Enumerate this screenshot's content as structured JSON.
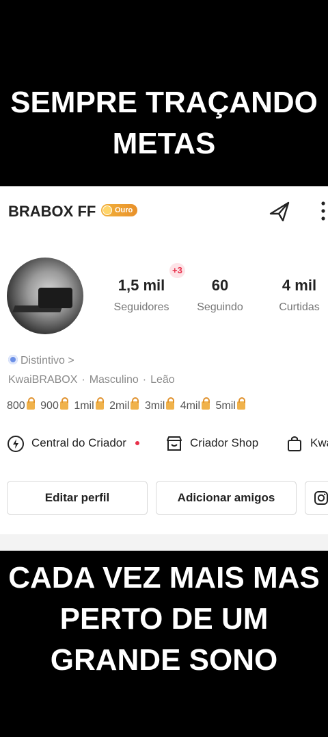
{
  "captions": {
    "top": [
      "SEMPRE TRAÇANDO",
      "METAS"
    ],
    "bottom": [
      "CADA VEZ MAIS MAS",
      "PERTO DE UM",
      "GRANDE SONO"
    ]
  },
  "profile": {
    "name": "BRABOX FF",
    "badge": "Ouro",
    "stats": {
      "followers": {
        "value": "1,5 mil",
        "label": "Seguidores",
        "delta": "+3"
      },
      "following": {
        "value": "60",
        "label": "Seguindo"
      },
      "likes": {
        "value": "4 mil",
        "label": "Curtidas"
      }
    },
    "distintivo": "Distintivo >",
    "meta": {
      "id": "KwaiBRABOX",
      "gender": "Masculino",
      "sign": "Leão",
      "separator": "·"
    },
    "goals": [
      "800",
      "900",
      "1mil",
      "2mil",
      "3mil",
      "4mil",
      "5mil"
    ]
  },
  "quick_links": {
    "central": "Central do Criador",
    "shop": "Criador Shop",
    "kwai": "Kwa"
  },
  "buttons": {
    "edit": "Editar perfil",
    "add": "Adicionar amigos"
  },
  "colors": {
    "badge": "#e8902a",
    "accent_red": "#e8304a",
    "lock": "#f0b24b"
  }
}
